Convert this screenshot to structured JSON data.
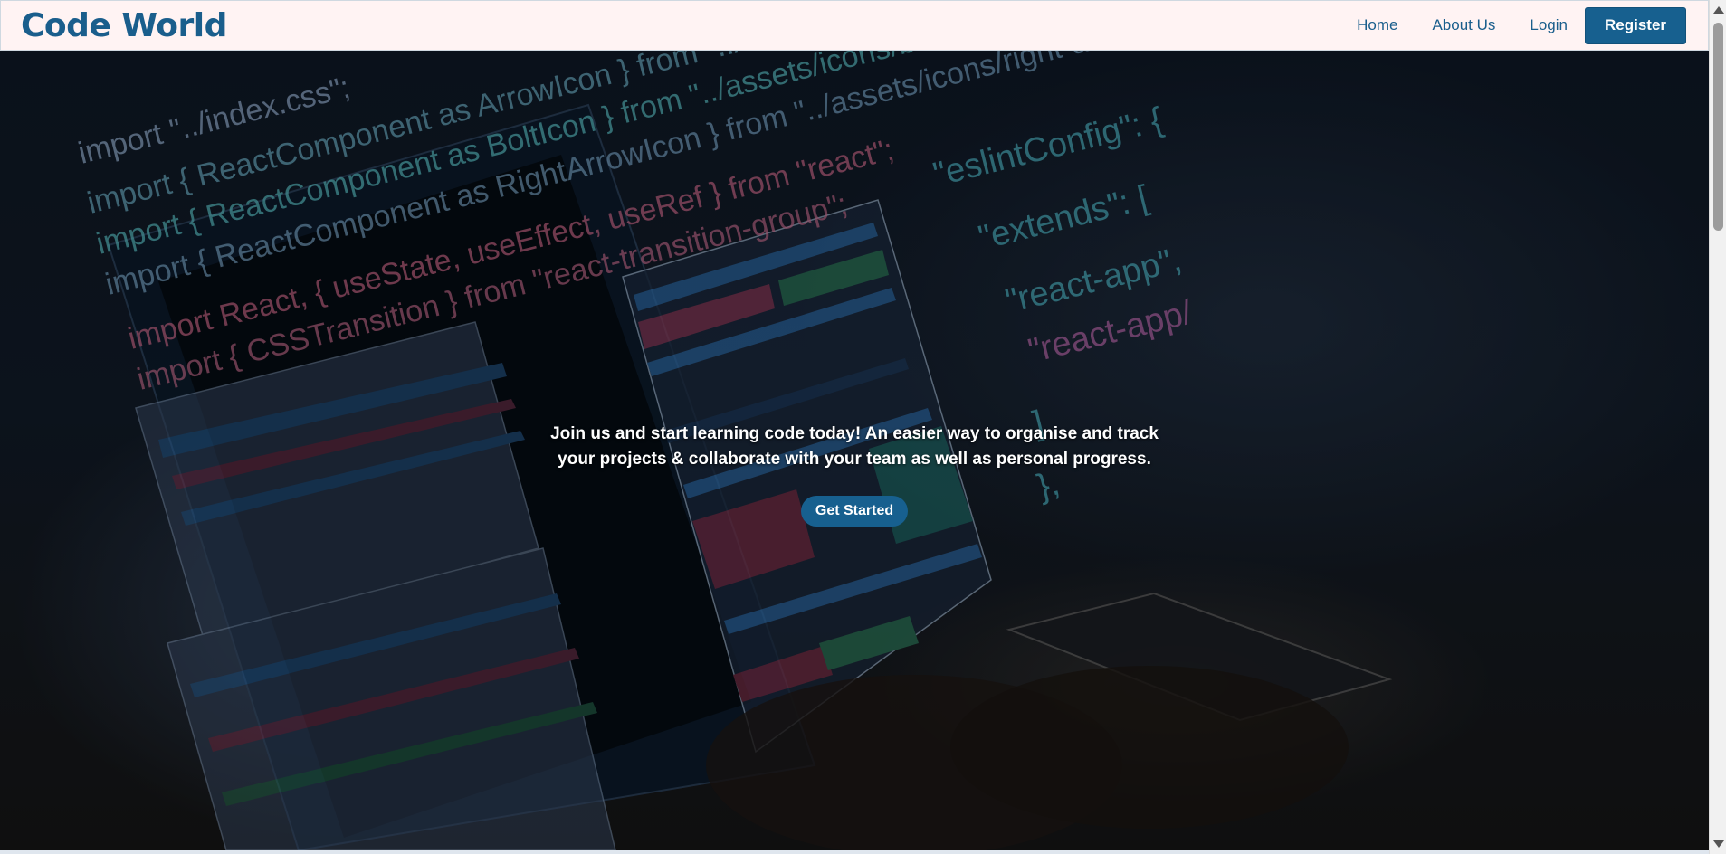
{
  "navbar": {
    "brand": "Code World",
    "links": [
      "Home",
      "About Us",
      "Login"
    ],
    "register_label": "Register"
  },
  "hero": {
    "text": "Join us and start learning code today! An easier way to organise and track your projects & collaborate with your team as well as personal progress.",
    "cta_label": "Get Started",
    "code_lines": [
      "import \"../index.css\";",
      "import { ReactComponent as ArrowIcon } from \"../assets/icons/arrow.svg\";",
      "import { ReactComponent as BoltIcon } from \"../assets/icons/bolt.svg\";",
      "import { ReactComponent as RightArrowIcon } from \"../assets/icons/right-arrow.svg\";",
      "import React, { useState, useEffect, useRef } from \"react\";",
      "import { CSSTransition } from \"react-transition-group\";"
    ],
    "config_lines": [
      "\"eslintConfig\": {",
      "\"extends\": [",
      "\"react-app\",",
      "\"react-app/"
    ]
  },
  "colors": {
    "brand": "#1a5e8c",
    "navbar_bg": "#fff3f3",
    "button": "#17608f"
  }
}
